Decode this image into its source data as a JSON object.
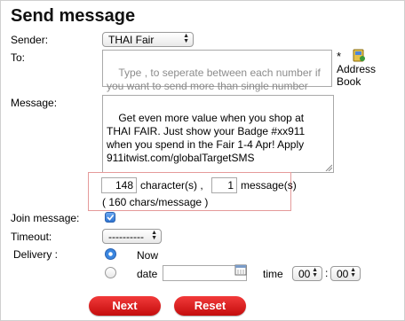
{
  "title": "Send message",
  "labels": {
    "sender": "Sender:",
    "to": "To:",
    "message": "Message:",
    "join": "Join message:",
    "timeout": "Timeout:",
    "delivery": "Delivery :"
  },
  "sender_value": "THAI Fair",
  "to_placeholder": "Type , to seperate between each number if you want to send more than single number",
  "required_mark": "*",
  "address_book_line1": "Address",
  "address_book_line2": "Book",
  "message_text": "Get even more value when you shop at THAI FAIR. Just show your Badge #xx911 when you spend in the Fair 1-4 Apr! Apply 911itwist.com/globalTargetSMS",
  "char_count": "148",
  "char_label": "character(s) ,",
  "msg_count": "1",
  "msg_label": "message(s)",
  "chars_per_message": "( 160 chars/message )",
  "join_checked": true,
  "timeout_value": "----------",
  "delivery_now": "Now",
  "delivery_date": "date",
  "time_label": "time",
  "hour_value": "00",
  "minute_value": "00",
  "time_separator": ":",
  "buttons": {
    "next": "Next",
    "reset": "Reset"
  },
  "colors": {
    "button_red": "#d41414",
    "checkbox_blue": "#3a86e0",
    "highlight_border": "#e59a9a"
  }
}
